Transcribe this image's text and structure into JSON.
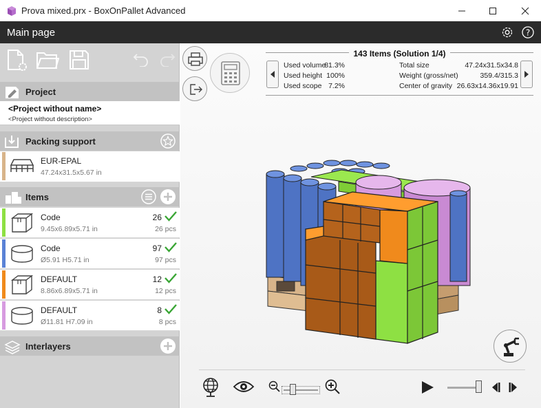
{
  "window": {
    "title": "Prova mixed.prx - BoxOnPallet Advanced",
    "controls": [
      "minimize",
      "maximize",
      "close"
    ]
  },
  "appbar": {
    "page_title": "Main page"
  },
  "toolbar": {
    "icons": [
      "new-project-icon",
      "open-folder-icon",
      "save-icon",
      "undo-icon",
      "redo-icon"
    ]
  },
  "project": {
    "section_label": "Project",
    "name": "<Project without name>",
    "description": "<Project without description>"
  },
  "packing_support": {
    "section_label": "Packing support",
    "item": {
      "name": "EUR-EPAL",
      "dimensions": "47.24x31.5x5.67 in",
      "color": "#d8b48a"
    }
  },
  "items": {
    "section_label": "Items",
    "list": [
      {
        "name": "Code",
        "dimensions": "9.45x6.89x5.71 in",
        "quantity": "26",
        "pcs": "26 pcs",
        "color": "#8ee043",
        "shape": "box"
      },
      {
        "name": "Code",
        "dimensions": "Ø5.91 H5.71 in",
        "quantity": "97",
        "pcs": "97 pcs",
        "color": "#5a82d6",
        "shape": "cylinder"
      },
      {
        "name": "DEFAULT",
        "dimensions": "8.86x6.89x5.71 in",
        "quantity": "12",
        "pcs": "12 pcs",
        "color": "#f08a1c",
        "shape": "box"
      },
      {
        "name": "DEFAULT",
        "dimensions": "Ø11.81 H7.09 in",
        "quantity": "8",
        "pcs": "8 pcs",
        "color": "#d79be0",
        "shape": "cylinder"
      }
    ]
  },
  "interlayers": {
    "section_label": "Interlayers"
  },
  "solution": {
    "title": "143 Items (Solution 1/4)",
    "stats_left": [
      {
        "label": "Used volume",
        "value": "81.3%"
      },
      {
        "label": "Used height",
        "value": "100%"
      },
      {
        "label": "Used scope",
        "value": "7.2%"
      }
    ],
    "stats_right": [
      {
        "label": "Total size",
        "value": "47.24x31.5x34.8"
      },
      {
        "label": "Weight (gross/net)",
        "value": "359.4/315.3"
      },
      {
        "label": "Center of gravity",
        "value": "26.63x14.36x19.91"
      }
    ]
  },
  "colors": {
    "appbar_bg": "#2b2b2b",
    "check_green": "#3aa635",
    "box_green": "#8ee043",
    "cyl_blue": "#5a82d6",
    "box_orange": "#f08a1c",
    "cyl_violet": "#d79be0"
  },
  "view_controls": {
    "icons": [
      "globe-icon",
      "eye-icon",
      "zoom-out-icon",
      "zoom-in-icon",
      "play-icon",
      "step-back-icon",
      "step-forward-icon"
    ],
    "zoom_level": 0.25,
    "speed_level": 0.9
  }
}
